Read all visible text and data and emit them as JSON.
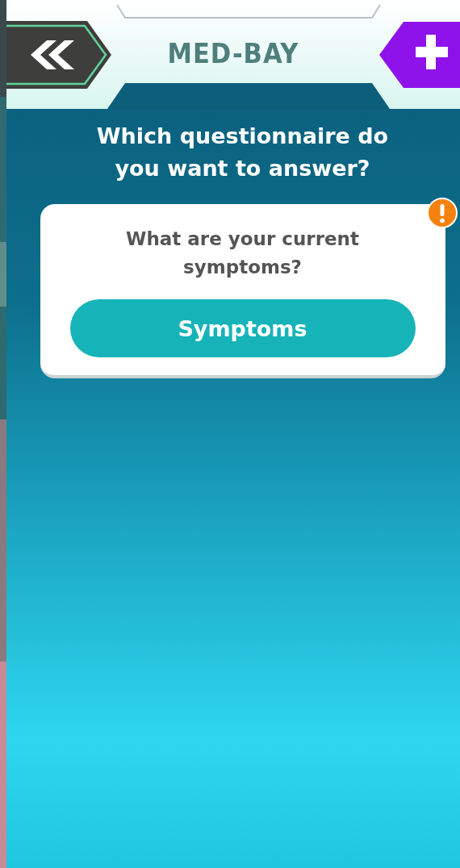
{
  "header": {
    "title": "MED-BAY"
  },
  "prompt": "Which questionnaire do you want to answer?",
  "questionnaires": [
    {
      "question": "What are your current symptoms?",
      "button": "Symptoms",
      "alert": true
    }
  ]
}
